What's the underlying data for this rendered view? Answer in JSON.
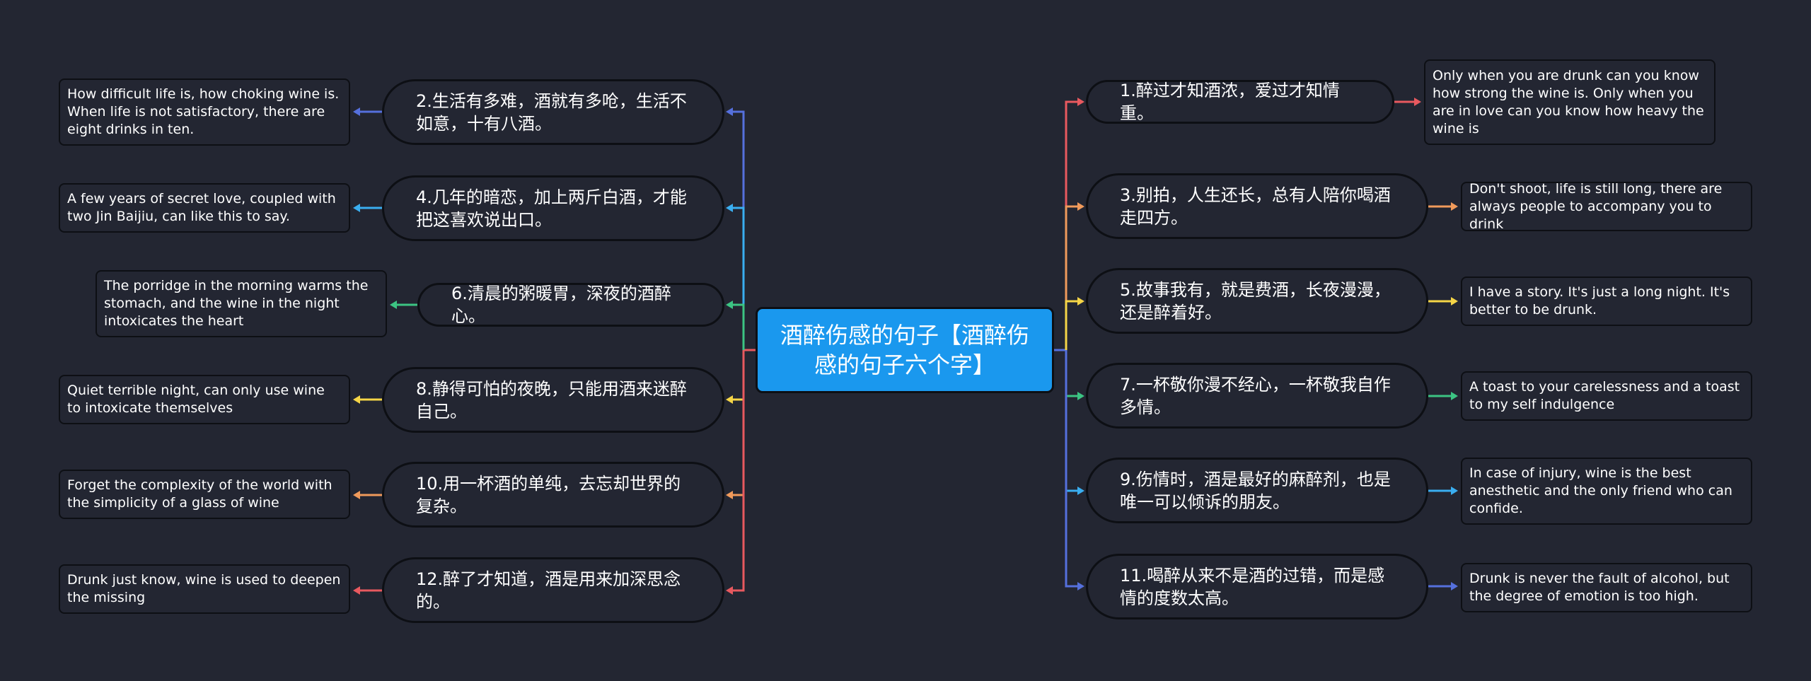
{
  "center": {
    "title": "酒醉伤感的句子【酒醉伤感的句子六个字】",
    "color": "#1a98ee"
  },
  "colors": {
    "red": "#e8595f",
    "orange": "#f09a5b",
    "yellow": "#f5d547",
    "green": "#3cc483",
    "cyan": "#3aaef0",
    "blue": "#5570dd"
  },
  "left": [
    {
      "label": "2.生活有多难，酒就有多呛，生活不如意，十有八酒。",
      "leaf": "How difficult life is, how choking wine is. When life is not satisfactory, there are eight drinks in ten.",
      "color": "#5570dd"
    },
    {
      "label": "4.几年的暗恋，加上两斤白酒，才能把这喜欢说出口。",
      "leaf": "A few years of secret love, coupled with two Jin Baijiu, can like this to say.",
      "color": "#3aaef0"
    },
    {
      "label": "6.清晨的粥暖胃，深夜的酒醉心。",
      "leaf": "The porridge in the morning warms the stomach, and the wine in the night intoxicates the heart",
      "color": "#3cc483"
    },
    {
      "label": "8.静得可怕的夜晚，只能用酒来迷醉自己。",
      "leaf": "Quiet terrible night, can only use wine to intoxicate themselves",
      "color": "#f5d547"
    },
    {
      "label": "10.用一杯酒的单纯，去忘却世界的复杂。",
      "leaf": "Forget the complexity of the world with the simplicity of a glass of wine",
      "color": "#f09a5b"
    },
    {
      "label": "12.醉了才知道，酒是用来加深思念的。",
      "leaf": "Drunk just know, wine is used to deepen the missing",
      "color": "#e8595f"
    }
  ],
  "right": [
    {
      "label": "1.醉过才知酒浓，爱过才知情重。",
      "leaf": "Only when you are drunk can you know how strong the wine is. Only when you are in love can you know how heavy the wine is",
      "color": "#e8595f"
    },
    {
      "label": "3.别拍，人生还长，总有人陪你喝酒走四方。",
      "leaf": "Don't shoot, life is still long, there are always people to accompany you to drink",
      "color": "#f09a5b"
    },
    {
      "label": "5.故事我有，就是费酒，长夜漫漫，还是醉着好。",
      "leaf": "I have a story. It's just a long night. It's better to be drunk.",
      "color": "#f5d547"
    },
    {
      "label": "7.一杯敬你漫不经心，一杯敬我自作多情。",
      "leaf": "A toast to your carelessness and a toast to my self indulgence",
      "color": "#3cc483"
    },
    {
      "label": "9.伤情时，酒是最好的麻醉剂，也是唯一可以倾诉的朋友。",
      "leaf": "In case of injury, wine is the best anesthetic and the only friend who can confide.",
      "color": "#3aaef0"
    },
    {
      "label": "11.喝醉从来不是酒的过错，而是感情的度数太高。",
      "leaf": "Drunk is never the fault of alcohol, but the degree of emotion is too high.",
      "color": "#5570dd"
    }
  ]
}
